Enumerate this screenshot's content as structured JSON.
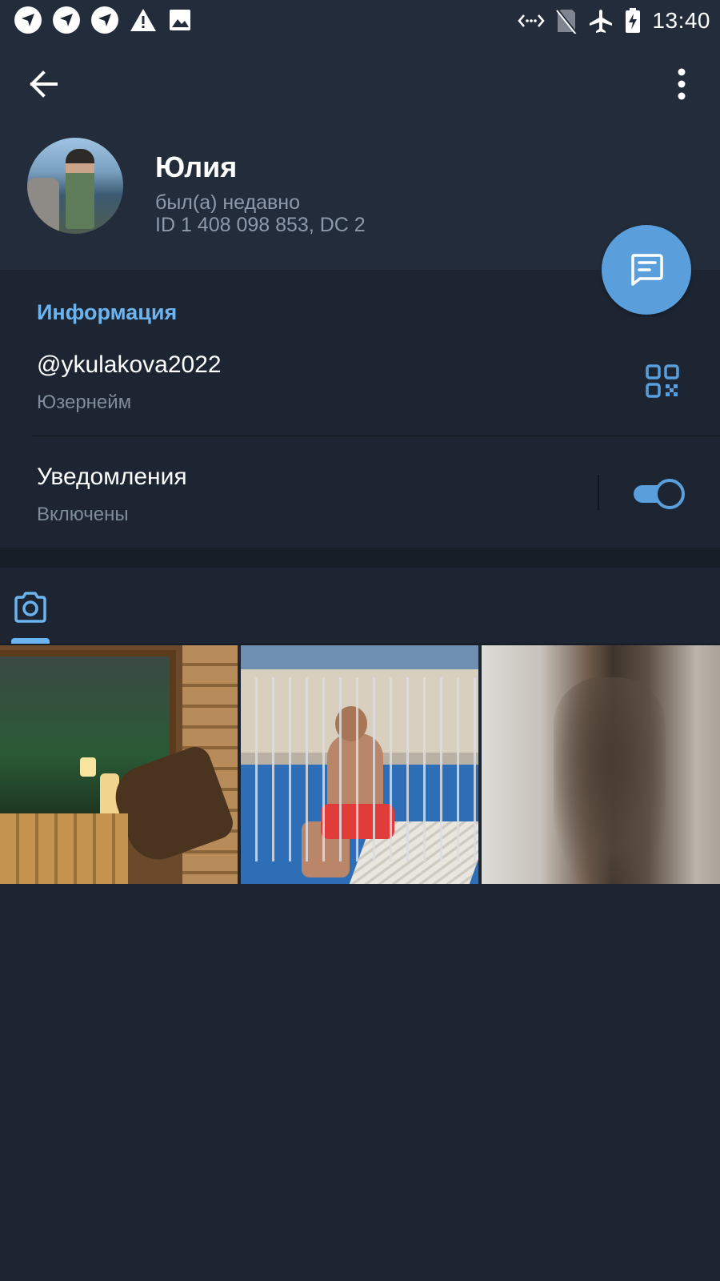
{
  "status_bar": {
    "time": "13:40",
    "left_icons": [
      "app-notification-icon",
      "app-notification-icon",
      "app-notification-icon",
      "warning-icon",
      "image-icon"
    ],
    "right_icons": [
      "data-transfer-icon",
      "no-sim-icon",
      "airplane-mode-icon",
      "battery-charging-icon"
    ]
  },
  "header": {
    "back_icon": "arrow-left-icon",
    "menu_icon": "more-vert-icon"
  },
  "profile": {
    "name": "Юлия",
    "last_seen": "был(а) недавно",
    "id_line": "ID 1 408 098 853, DC 2"
  },
  "fab": {
    "icon": "message-icon",
    "color": "#5a9fdb"
  },
  "info": {
    "title": "Информация",
    "username": "@ykulakova2022",
    "username_label": "Юзернейм",
    "qr_icon": "qr-code-icon",
    "notifications_title": "Уведомления",
    "notifications_status": "Включены",
    "notifications_enabled": true
  },
  "media": {
    "active_tab_icon": "camera-icon",
    "photos": [
      "photo-sauna",
      "photo-pool",
      "photo-blurred"
    ]
  },
  "colors": {
    "background": "#1d2533",
    "header": "#222c3a",
    "accent": "#5a9fdb",
    "accent_text": "#6cb4ef",
    "secondary_text": "#7f8c9c"
  }
}
